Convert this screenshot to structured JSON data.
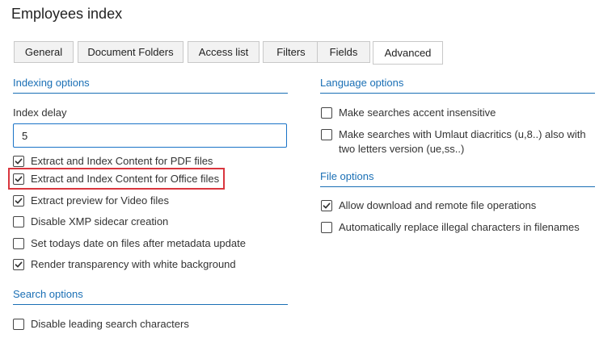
{
  "page": {
    "title": "Employees index"
  },
  "tabs": [
    {
      "label": "General"
    },
    {
      "label": "Document Folders"
    },
    {
      "label": "Access list"
    },
    {
      "label": "Filters"
    },
    {
      "label": "Fields"
    },
    {
      "label": "Advanced",
      "active": true
    }
  ],
  "indexing": {
    "header": "Indexing options",
    "delay_label": "Index delay",
    "delay_value": "5",
    "options": [
      {
        "label": "Extract and Index Content for PDF files",
        "checked": true
      },
      {
        "label": "Extract and Index Content for Office files",
        "checked": true
      },
      {
        "label": "Extract preview for Video files",
        "checked": true
      },
      {
        "label": "Disable XMP sidecar creation",
        "checked": false
      },
      {
        "label": "Set todays date on files after metadata update",
        "checked": false
      },
      {
        "label": "Render transparency with white background",
        "checked": true
      }
    ]
  },
  "search": {
    "header": "Search options",
    "options": [
      {
        "label": "Disable leading search characters",
        "checked": false
      }
    ]
  },
  "language": {
    "header": "Language options",
    "options": [
      {
        "label": "Make searches accent insensitive",
        "checked": false
      },
      {
        "label": "Make searches with Umlaut diacritics (u,8..) also with two letters version (ue,ss..)",
        "checked": false
      }
    ]
  },
  "file": {
    "header": "File options",
    "options": [
      {
        "label": "Allow download and remote file operations",
        "checked": true
      },
      {
        "label": "Automatically replace illegal characters in filenames",
        "checked": false
      }
    ]
  },
  "colors": {
    "accent": "#1a6fb5",
    "highlight": "#d9363e",
    "check": "#333333"
  },
  "icons": {
    "check": "check-mark-icon"
  }
}
